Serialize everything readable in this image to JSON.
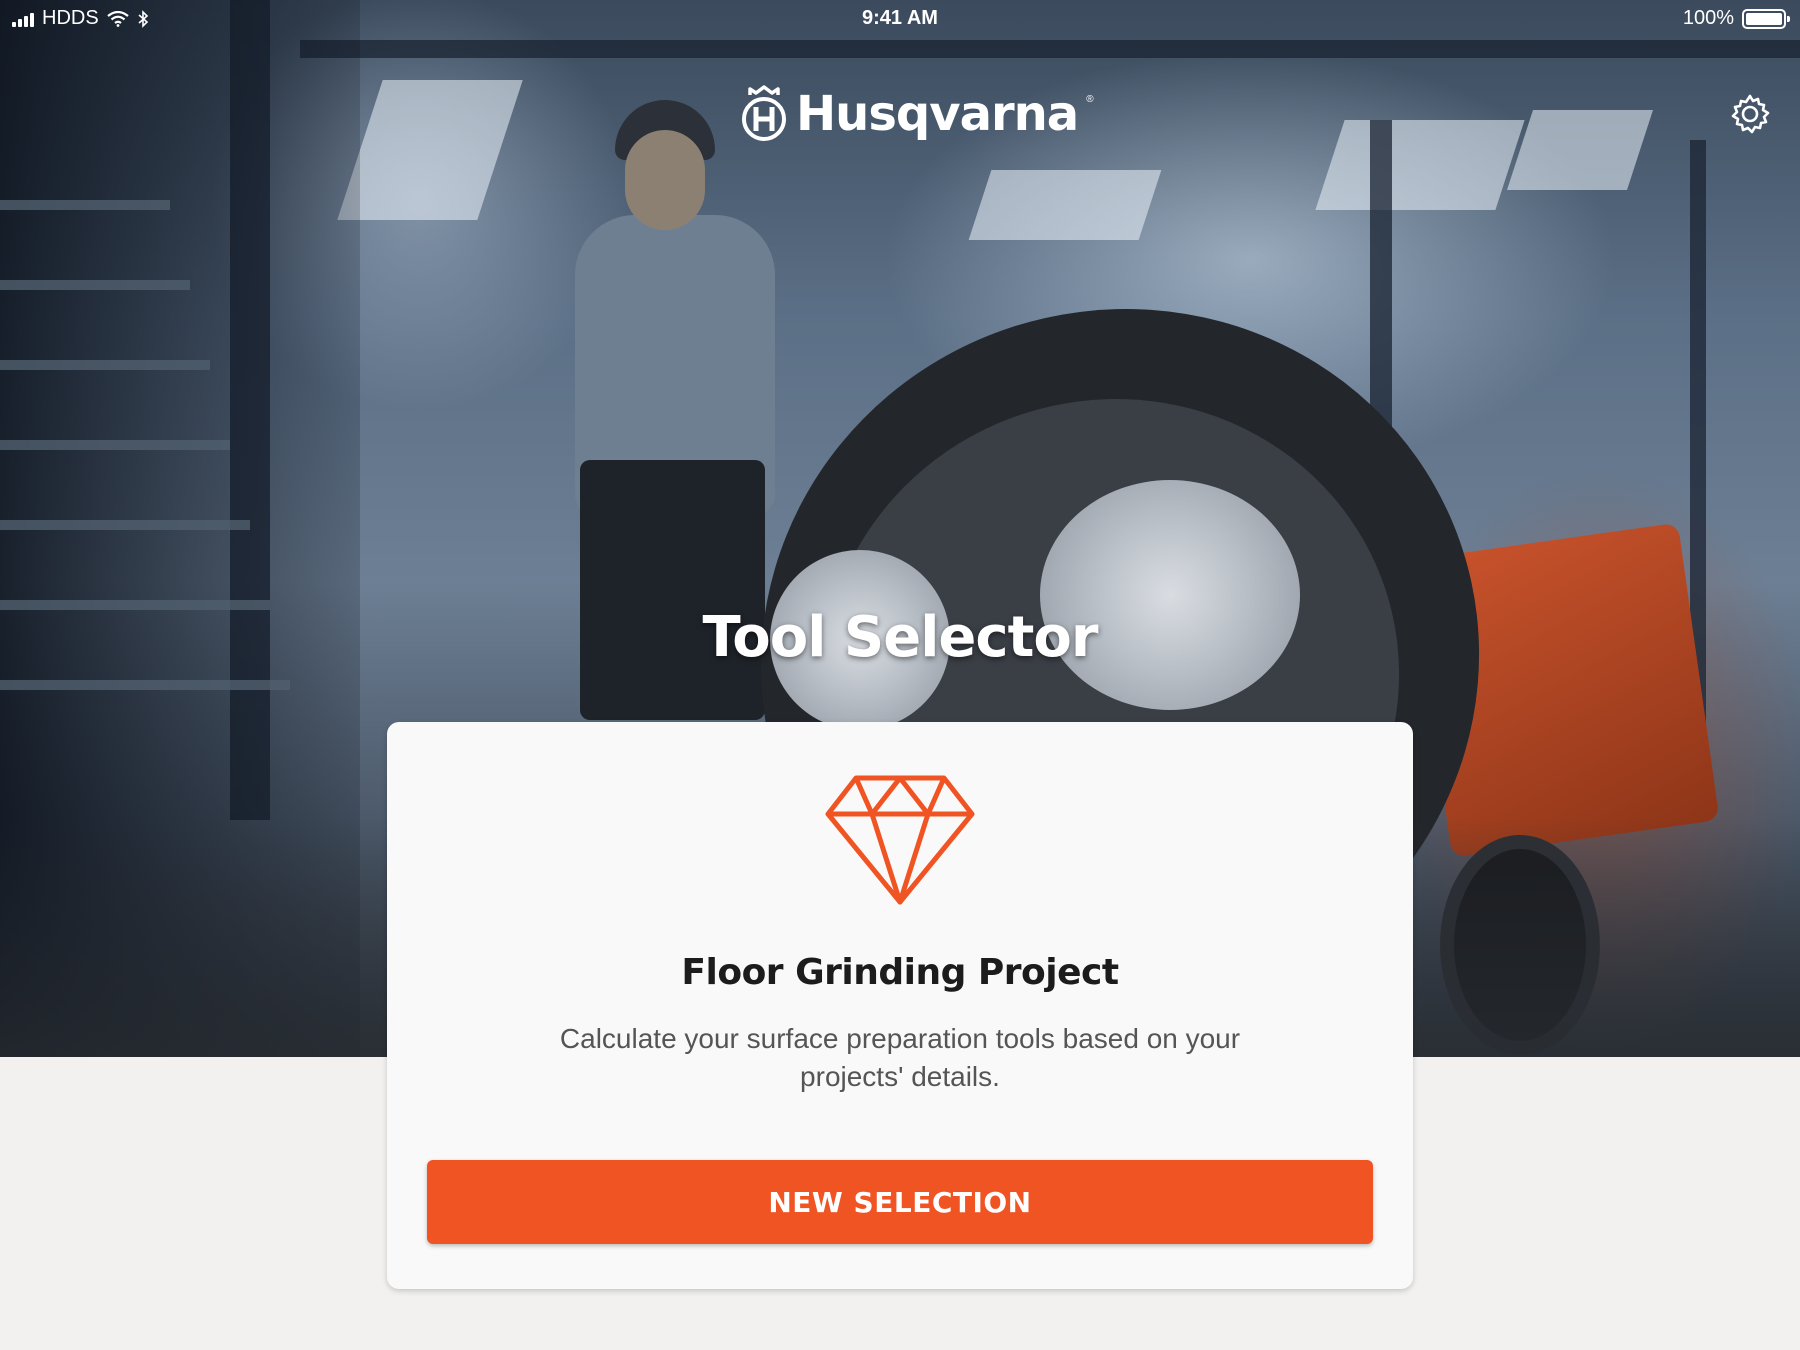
{
  "status_bar": {
    "carrier": "HDDS",
    "time": "9:41 AM",
    "battery": "100%",
    "battery_level": 1.0,
    "icons": [
      "signal-icon",
      "wifi-icon",
      "bluetooth-icon",
      "battery-icon"
    ]
  },
  "header": {
    "brand": "Husqvarna",
    "brand_mark": "®",
    "settings_icon": "gear-icon"
  },
  "hero": {
    "title": "Tool Selector"
  },
  "card": {
    "icon": "diamond-icon",
    "title": "Floor Grinding Project",
    "description": "Calculate your surface preparation tools based on your projects' details.",
    "button_label": "NEW SELECTION"
  },
  "colors": {
    "accent": "#f05423",
    "card_bg": "#f9f9f9",
    "page_bg": "#f2f1ef"
  }
}
